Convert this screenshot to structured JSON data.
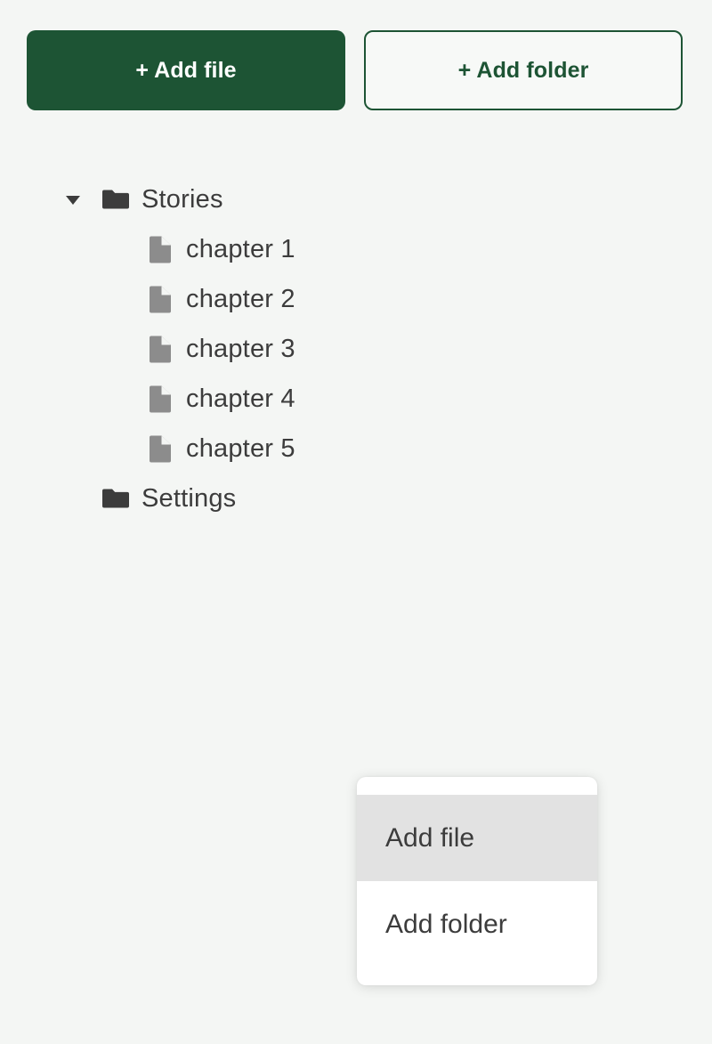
{
  "theme": {
    "background": "#f4f6f4",
    "accent_green": "#1d5434",
    "text_color": "#3c3c3c",
    "folder_icon_color": "#3c3c3c",
    "file_icon_color": "#8c8c8c",
    "menu_highlight": "#e2e2e2"
  },
  "toolbar": {
    "add_file_label": "+ Add file",
    "add_folder_label": "+ Add folder"
  },
  "tree": {
    "items": [
      {
        "label": "Stories",
        "type": "folder",
        "depth": 0,
        "expanded": true,
        "caret": "chevron-down-icon"
      },
      {
        "label": "chapter 1",
        "type": "file",
        "depth": 1
      },
      {
        "label": "chapter 2",
        "type": "file",
        "depth": 1
      },
      {
        "label": "chapter 3",
        "type": "file",
        "depth": 1
      },
      {
        "label": "chapter 4",
        "type": "file",
        "depth": 1
      },
      {
        "label": "chapter 5",
        "type": "file",
        "depth": 1
      },
      {
        "label": "Settings",
        "type": "folder",
        "depth": 0,
        "expanded": false,
        "caret": null
      }
    ]
  },
  "context_menu": {
    "visible": true,
    "items": [
      {
        "label": "Add file",
        "highlighted": true
      },
      {
        "label": "Add folder",
        "highlighted": false
      }
    ]
  }
}
